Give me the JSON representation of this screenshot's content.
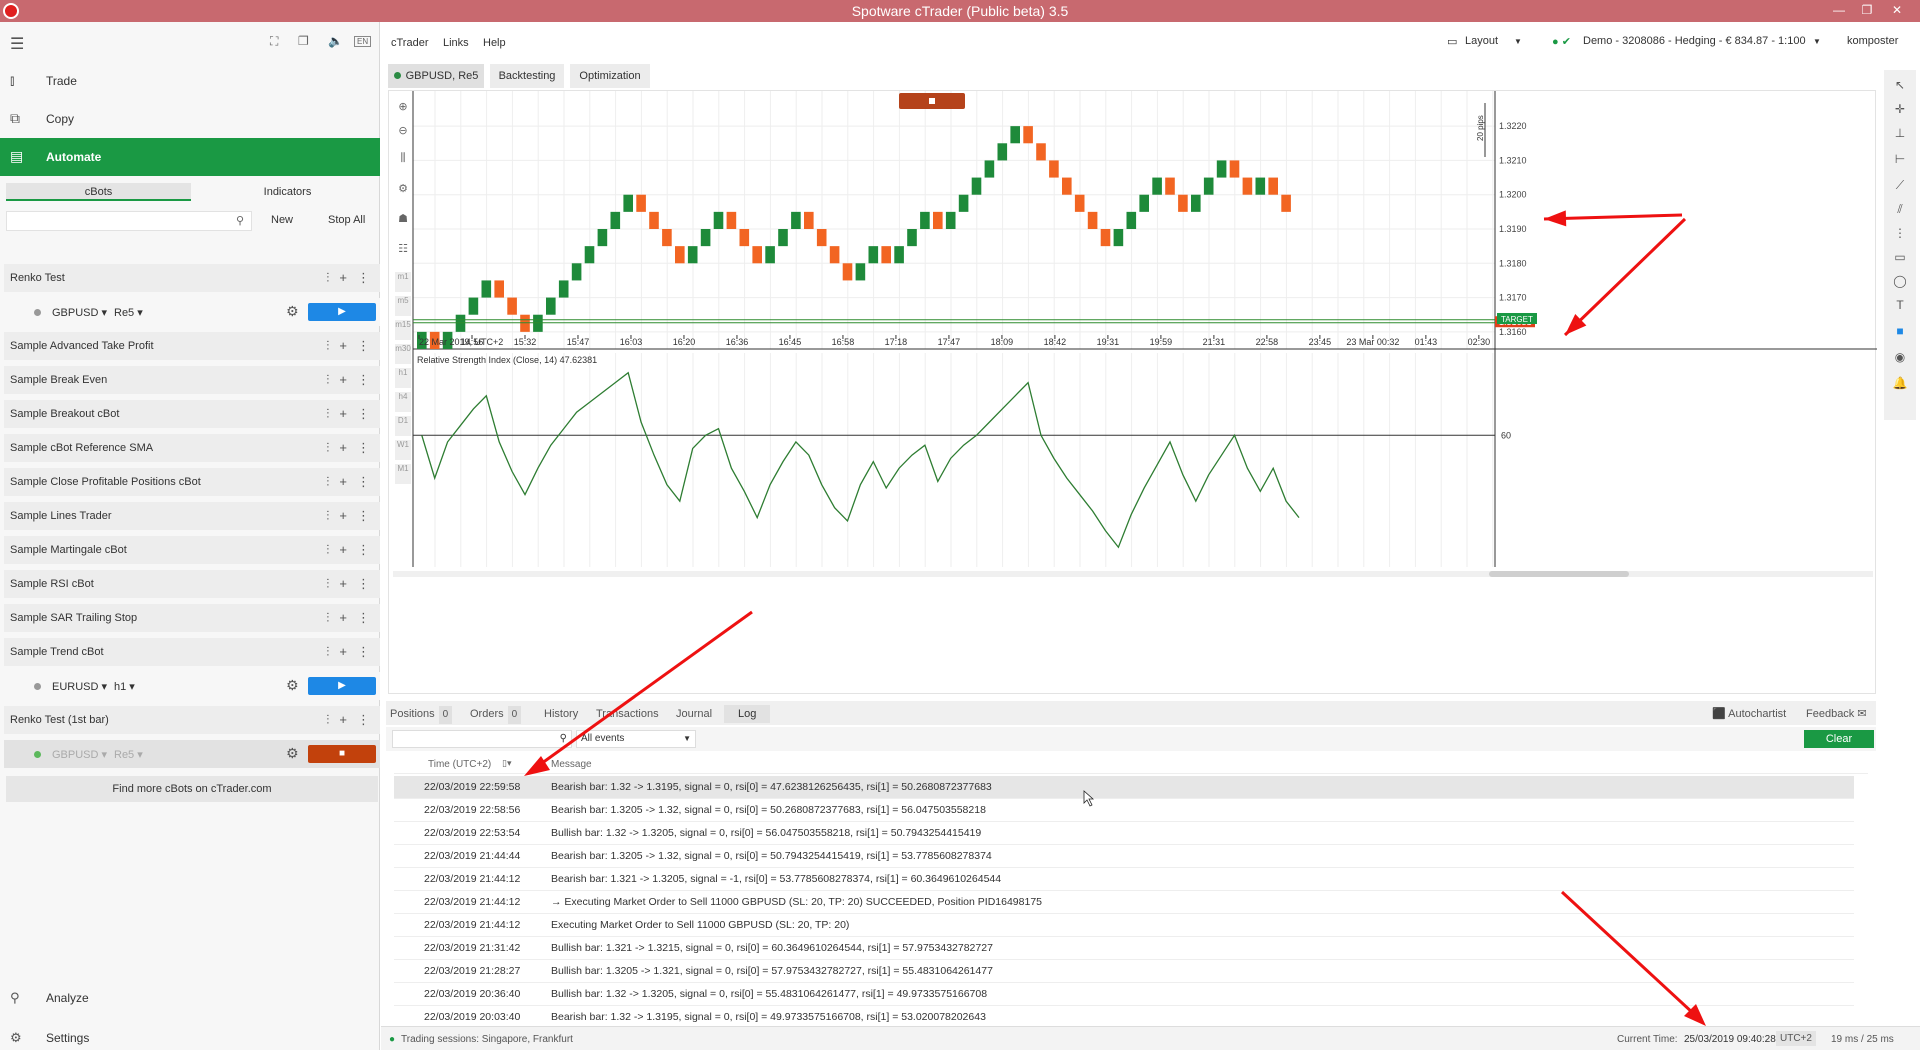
{
  "window": {
    "title": "Spotware cTrader (Public beta) 3.5",
    "controls": [
      "—",
      "❐",
      "✕"
    ]
  },
  "left_nav": {
    "lang": "EN",
    "items": [
      {
        "label": "Trade",
        "icon": "trade-icon"
      },
      {
        "label": "Copy",
        "icon": "copy-icon"
      },
      {
        "label": "Automate",
        "icon": "automate-icon",
        "active": true
      }
    ],
    "subtabs": [
      "cBots",
      "Indicators"
    ],
    "new_label": "New",
    "stop_all_label": "Stop All",
    "bots": [
      {
        "name": "Renko Test"
      },
      {
        "name": "Sample Advanced Take Profit"
      },
      {
        "name": "Sample Break Even"
      },
      {
        "name": "Sample Breakout cBot"
      },
      {
        "name": "Sample cBot Reference SMA"
      },
      {
        "name": "Sample Close Profitable Positions cBot"
      },
      {
        "name": "Sample Lines Trader"
      },
      {
        "name": "Sample Martingale cBot"
      },
      {
        "name": "Sample RSI cBot"
      },
      {
        "name": "Sample SAR Trailing Stop"
      },
      {
        "name": "Sample Trend cBot"
      },
      {
        "name": "Renko Test (1st bar)"
      }
    ],
    "instances": [
      {
        "symbol": "GBPUSD",
        "timeframe": "Re5",
        "state": "stopped"
      },
      {
        "symbol": "EURUSD",
        "timeframe": "h1",
        "state": "stopped"
      },
      {
        "symbol": "GBPUSD",
        "timeframe": "Re5",
        "state": "running"
      }
    ],
    "find_more": "Find more cBots on cTrader.com",
    "analyze": "Analyze",
    "settings": "Settings"
  },
  "menubar": {
    "items": [
      "cTrader",
      "Links",
      "Help"
    ],
    "layout": "Layout",
    "account": "Demo - 3208086 - Hedging - € 834.87 - 1:100",
    "user": "komposter"
  },
  "chart_tabs": [
    "GBPUSD, Re5",
    "Backtesting",
    "Optimization"
  ],
  "chart": {
    "pips_label": "20 pips",
    "price_ticks": [
      "1.3220",
      "1.3210",
      "1.3200",
      "1.3190",
      "1.3180",
      "1.3170",
      "1.3160"
    ],
    "current_price": "1.31631",
    "target_label": "TARGET",
    "time_labels": [
      "22 Mar 2019, UTC+2",
      "14:56",
      "15:32",
      "15:47",
      "16:03",
      "16:20",
      "16:36",
      "16:45",
      "16:58",
      "17:18",
      "17:47",
      "18:09",
      "18:42",
      "19:31",
      "19:59",
      "21:31",
      "22:58",
      "23:45",
      "23 Mar 00:32",
      "01:43",
      "02:30"
    ],
    "rsi_title": "Relative Strength Index (Close, 14) 47.62381",
    "rsi_level": "60",
    "bull_color": "#1e8a3a",
    "bear_color": "#f26522",
    "timeframes": [
      "m1",
      "m5",
      "m15",
      "m30",
      "h1",
      "h4",
      "D1",
      "W1",
      "M1"
    ]
  },
  "chart_data": {
    "type": "renko",
    "box_size_pips": 5,
    "bricks": [
      {
        "close": 1.316,
        "dir": "bull"
      },
      {
        "close": 1.3155,
        "dir": "bear"
      },
      {
        "close": 1.316,
        "dir": "bull"
      },
      {
        "close": 1.3165,
        "dir": "bull"
      },
      {
        "close": 1.317,
        "dir": "bull"
      },
      {
        "close": 1.3175,
        "dir": "bull"
      },
      {
        "close": 1.317,
        "dir": "bear"
      },
      {
        "close": 1.3165,
        "dir": "bear"
      },
      {
        "close": 1.316,
        "dir": "bear"
      },
      {
        "close": 1.3165,
        "dir": "bull"
      },
      {
        "close": 1.317,
        "dir": "bull"
      },
      {
        "close": 1.3175,
        "dir": "bull"
      },
      {
        "close": 1.318,
        "dir": "bull"
      },
      {
        "close": 1.3185,
        "dir": "bull"
      },
      {
        "close": 1.319,
        "dir": "bull"
      },
      {
        "close": 1.3195,
        "dir": "bull"
      },
      {
        "close": 1.32,
        "dir": "bull"
      },
      {
        "close": 1.3195,
        "dir": "bear"
      },
      {
        "close": 1.319,
        "dir": "bear"
      },
      {
        "close": 1.3185,
        "dir": "bear"
      },
      {
        "close": 1.318,
        "dir": "bear"
      },
      {
        "close": 1.3185,
        "dir": "bull"
      },
      {
        "close": 1.319,
        "dir": "bull"
      },
      {
        "close": 1.3195,
        "dir": "bull"
      },
      {
        "close": 1.319,
        "dir": "bear"
      },
      {
        "close": 1.3185,
        "dir": "bear"
      },
      {
        "close": 1.318,
        "dir": "bear"
      },
      {
        "close": 1.3185,
        "dir": "bull"
      },
      {
        "close": 1.319,
        "dir": "bull"
      },
      {
        "close": 1.3195,
        "dir": "bull"
      },
      {
        "close": 1.319,
        "dir": "bear"
      },
      {
        "close": 1.3185,
        "dir": "bear"
      },
      {
        "close": 1.318,
        "dir": "bear"
      },
      {
        "close": 1.3175,
        "dir": "bear"
      },
      {
        "close": 1.318,
        "dir": "bull"
      },
      {
        "close": 1.3185,
        "dir": "bull"
      },
      {
        "close": 1.318,
        "dir": "bear"
      },
      {
        "close": 1.3185,
        "dir": "bull"
      },
      {
        "close": 1.319,
        "dir": "bull"
      },
      {
        "close": 1.3195,
        "dir": "bull"
      },
      {
        "close": 1.319,
        "dir": "bear"
      },
      {
        "close": 1.3195,
        "dir": "bull"
      },
      {
        "close": 1.32,
        "dir": "bull"
      },
      {
        "close": 1.3205,
        "dir": "bull"
      },
      {
        "close": 1.321,
        "dir": "bull"
      },
      {
        "close": 1.3215,
        "dir": "bull"
      },
      {
        "close": 1.322,
        "dir": "bull"
      },
      {
        "close": 1.3215,
        "dir": "bear"
      },
      {
        "close": 1.321,
        "dir": "bear"
      },
      {
        "close": 1.3205,
        "dir": "bear"
      },
      {
        "close": 1.32,
        "dir": "bear"
      },
      {
        "close": 1.3195,
        "dir": "bear"
      },
      {
        "close": 1.319,
        "dir": "bear"
      },
      {
        "close": 1.3185,
        "dir": "bear"
      },
      {
        "close": 1.319,
        "dir": "bull"
      },
      {
        "close": 1.3195,
        "dir": "bull"
      },
      {
        "close": 1.32,
        "dir": "bull"
      },
      {
        "close": 1.3205,
        "dir": "bull"
      },
      {
        "close": 1.32,
        "dir": "bear"
      },
      {
        "close": 1.3195,
        "dir": "bear"
      },
      {
        "close": 1.32,
        "dir": "bull"
      },
      {
        "close": 1.3205,
        "dir": "bull"
      },
      {
        "close": 1.321,
        "dir": "bull"
      },
      {
        "close": 1.3205,
        "dir": "bear"
      },
      {
        "close": 1.32,
        "dir": "bear"
      },
      {
        "close": 1.3205,
        "dir": "bull"
      },
      {
        "close": 1.32,
        "dir": "bear"
      },
      {
        "close": 1.3195,
        "dir": "bear"
      }
    ],
    "rsi_series": [
      60,
      47,
      58,
      63,
      68,
      72,
      58,
      49,
      42,
      50,
      57,
      62,
      67,
      70,
      73,
      76,
      79,
      64,
      54,
      45,
      40,
      56,
      60,
      62,
      50,
      43,
      35,
      45,
      52,
      58,
      54,
      45,
      38,
      34,
      45,
      52,
      44,
      50,
      54,
      57,
      46,
      53,
      57,
      60,
      64,
      68,
      72,
      76,
      60,
      53,
      47,
      42,
      37,
      31,
      26,
      36,
      44,
      51,
      58,
      48,
      40,
      48,
      54,
      60,
      50,
      43,
      50,
      40,
      35
    ],
    "rsi_level": 60,
    "current_price": 1.31631,
    "price_range": [
      1.3155,
      1.3225
    ]
  },
  "bottom_panel": {
    "tabs": [
      {
        "label": "Positions",
        "count": "0"
      },
      {
        "label": "Orders",
        "count": "0"
      },
      {
        "label": "History"
      },
      {
        "label": "Transactions"
      },
      {
        "label": "Journal"
      },
      {
        "label": "Log",
        "active": true
      }
    ],
    "autochartist": "Autochartist",
    "feedback": "Feedback",
    "filter_value": "All events",
    "clear_label": "Clear",
    "col_time": "Time (UTC+2)",
    "col_message": "Message",
    "rows": [
      {
        "time": "22/03/2019 22:59:58",
        "msg": "Bearish bar: 1.32 -> 1.3195, signal = 0, rsi[0] = 47.6238126256435, rsi[1] = 50.2680872377683",
        "sel": true
      },
      {
        "time": "22/03/2019 22:58:56",
        "msg": "Bearish bar: 1.3205 -> 1.32, signal = 0, rsi[0] = 50.2680872377683, rsi[1] = 56.047503558218"
      },
      {
        "time": "22/03/2019 22:53:54",
        "msg": "Bullish bar: 1.32 -> 1.3205, signal = 0, rsi[0] = 56.047503558218, rsi[1] = 50.7943254415419"
      },
      {
        "time": "22/03/2019 21:44:44",
        "msg": "Bearish bar: 1.3205 -> 1.32, signal = 0, rsi[0] = 50.7943254415419, rsi[1] = 53.7785608278374"
      },
      {
        "time": "22/03/2019 21:44:12",
        "msg": "Bearish bar: 1.321 -> 1.3205, signal = -1, rsi[0] = 53.7785608278374, rsi[1] = 60.3649610264544"
      },
      {
        "time": "22/03/2019 21:44:12",
        "msg": "→ Executing Market Order to Sell 11000 GBPUSD (SL: 20, TP: 20) SUCCEEDED, Position PID16498175"
      },
      {
        "time": "22/03/2019 21:44:12",
        "msg": "Executing Market Order to Sell 11000 GBPUSD (SL: 20, TP: 20)"
      },
      {
        "time": "22/03/2019 21:31:42",
        "msg": "Bullish bar: 1.321 -> 1.3215, signal = 0, rsi[0] = 60.3649610264544, rsi[1] = 57.9753432782727"
      },
      {
        "time": "22/03/2019 21:28:27",
        "msg": "Bullish bar: 1.3205 -> 1.321, signal = 0, rsi[0] = 57.9753432782727, rsi[1] = 55.4831064261477"
      },
      {
        "time": "22/03/2019 20:36:40",
        "msg": "Bullish bar: 1.32 -> 1.3205, signal = 0, rsi[0] = 55.4831064261477, rsi[1] = 49.9733575166708"
      },
      {
        "time": "22/03/2019 20:03:40",
        "msg": "Bearish bar: 1.32 -> 1.3195, signal = 0, rsi[0] = 49.9733575166708, rsi[1] = 53.020078202643"
      }
    ]
  },
  "status": {
    "sessions": "Trading sessions:  Singapore, Frankfurt",
    "current_time_label": "Current Time:",
    "current_time": "25/03/2019 09:40:28",
    "tz": "UTC+2",
    "latency": "19 ms / 25 ms"
  }
}
